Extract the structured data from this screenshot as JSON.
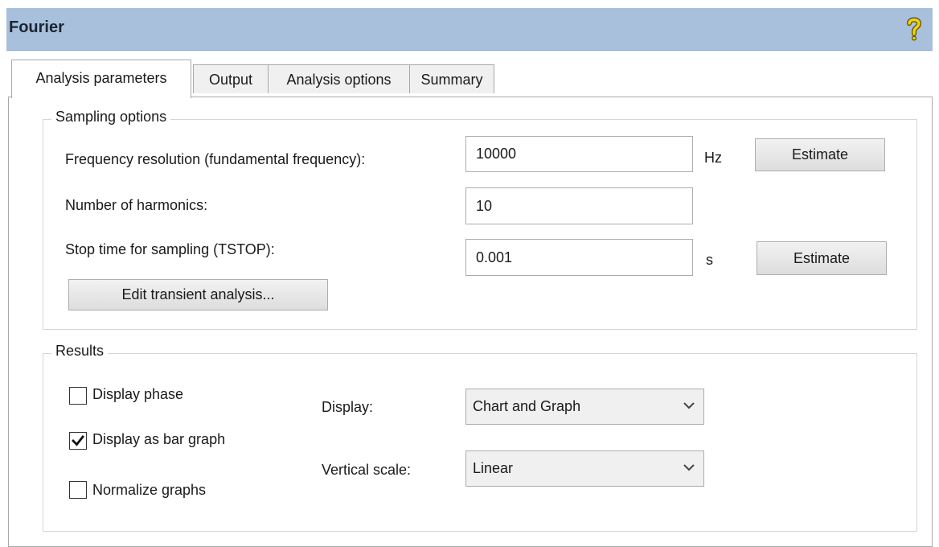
{
  "window": {
    "title": "Fourier",
    "help_icon": "help-question-icon"
  },
  "tabs": [
    {
      "label": "Analysis parameters",
      "active": true
    },
    {
      "label": "Output",
      "active": false
    },
    {
      "label": "Analysis options",
      "active": false
    },
    {
      "label": "Summary",
      "active": false
    }
  ],
  "sampling": {
    "legend": "Sampling options",
    "freq_label": "Frequency resolution (fundamental frequency):",
    "freq_value": "10000",
    "freq_unit": "Hz",
    "freq_estimate": "Estimate",
    "harmonics_label": "Number of harmonics:",
    "harmonics_value": "10",
    "tstop_label": "Stop time for sampling (TSTOP):",
    "tstop_value": "0.001",
    "tstop_unit": "s",
    "tstop_estimate": "Estimate",
    "edit_transient": "Edit transient analysis..."
  },
  "results": {
    "legend": "Results",
    "display_phase": {
      "label": "Display phase",
      "checked": false
    },
    "display_bar": {
      "label": "Display as bar graph",
      "checked": true
    },
    "normalize": {
      "label": "Normalize graphs",
      "checked": false
    },
    "display_label": "Display:",
    "display_value": "Chart and Graph",
    "vscale_label": "Vertical scale:",
    "vscale_value": "Linear"
  },
  "colors": {
    "titlebar": "#a8c0dc",
    "panel_border": "#a9a9a9",
    "group_border": "#d6d6d6"
  }
}
